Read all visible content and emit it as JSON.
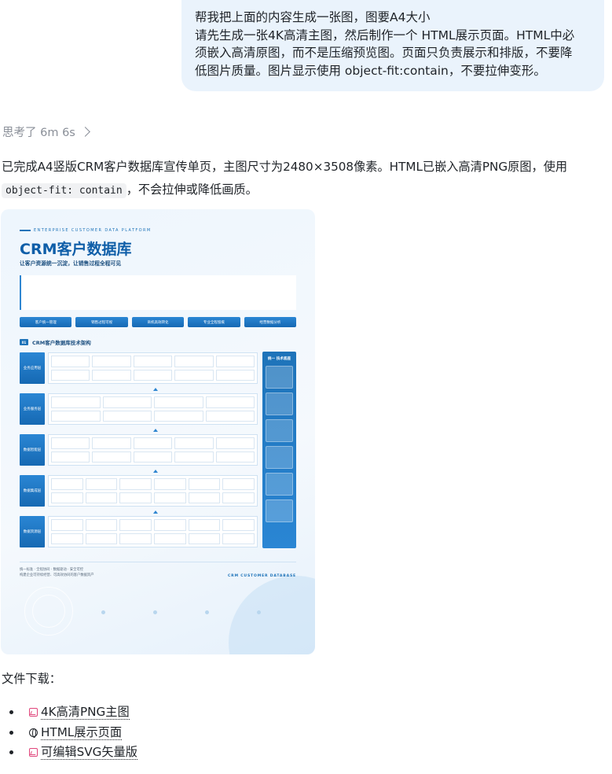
{
  "user_message": {
    "lines": [
      "帮我把上面的内容生成一张图，图要A4大小",
      "请先生成一张4K高清主图，然后制作一个 HTML展示页面。HTML中必",
      "须嵌入高清原图，而不是压缩预览图。页面只负责展示和排版，不要降",
      "低图片质量。图片显示使用 object-fit:contain，不要拉伸变形。"
    ]
  },
  "thought": {
    "label": "思考了 6m 6s"
  },
  "reply": {
    "line1": "已完成A4竖版CRM客户数据库宣传单页，主图尺寸为2480×3508像素。HTML已嵌入高清PNG原图，使用",
    "code": "object-fit: contain",
    "line2_rest": "，不会拉伸或降低画质。"
  },
  "poster": {
    "tag": "ENTERPRISE CUSTOMER DATA PLATFORM",
    "title": "CRM客户数据库",
    "subtitle": "让客户资源统一沉淀，让销售过程全程可见",
    "buttons": [
      "客户统一管理",
      "销售过程可视",
      "商机高效转化",
      "专业全程留痕",
      "经营数据分析"
    ],
    "section_num": "01",
    "section_title": "CRM客户数据库技术架构",
    "layers": [
      "业务应用层",
      "业务服务层",
      "数据智能层",
      "数据集成层",
      "数据资源层"
    ],
    "side_title": "统一 技术底座",
    "footer_line1": "统一标准 · 全程协同 · 数据驱动 · 安全可控",
    "footer_line2": "构建企业可持续经营、可高效协同的客户数据资产",
    "footer_right": "CRM CUSTOMER DATABASE"
  },
  "downloads": {
    "label": "文件下载：",
    "items": [
      {
        "icon": "image-icon",
        "label": "4K高清PNG主图"
      },
      {
        "icon": "globe-icon",
        "label": "HTML展示页面"
      },
      {
        "icon": "image-icon",
        "label": "可编辑SVG矢量版"
      }
    ]
  }
}
